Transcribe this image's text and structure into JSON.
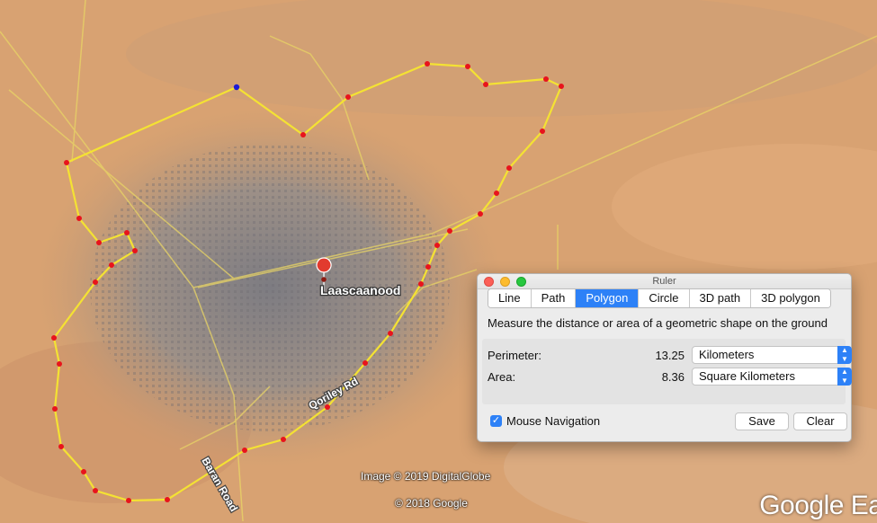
{
  "map": {
    "place_label": "Laascaanood",
    "road_labels": [
      "Qoriley Rd",
      "Baran Road"
    ],
    "credits": [
      "Image © 2019 DigitalGlobe",
      "© 2018 Google"
    ],
    "brand": "Google Earth",
    "polygon_color": "#f4e233",
    "vertex_color": "#e8141c",
    "start_vertex_color": "#1c1cd6"
  },
  "ruler": {
    "window_title": "Ruler",
    "tabs": [
      {
        "label": "Line",
        "active": false
      },
      {
        "label": "Path",
        "active": false
      },
      {
        "label": "Polygon",
        "active": true
      },
      {
        "label": "Circle",
        "active": false
      },
      {
        "label": "3D path",
        "active": false
      },
      {
        "label": "3D polygon",
        "active": false
      }
    ],
    "description": "Measure the distance or area of a geometric shape on the ground",
    "perimeter": {
      "label": "Perimeter:",
      "value": "13.25",
      "unit": "Kilometers"
    },
    "area": {
      "label": "Area:",
      "value": "8.36",
      "unit": "Square Kilometers"
    },
    "mouse_navigation": {
      "label": "Mouse Navigation",
      "checked": true
    },
    "save_label": "Save",
    "clear_label": "Clear"
  }
}
